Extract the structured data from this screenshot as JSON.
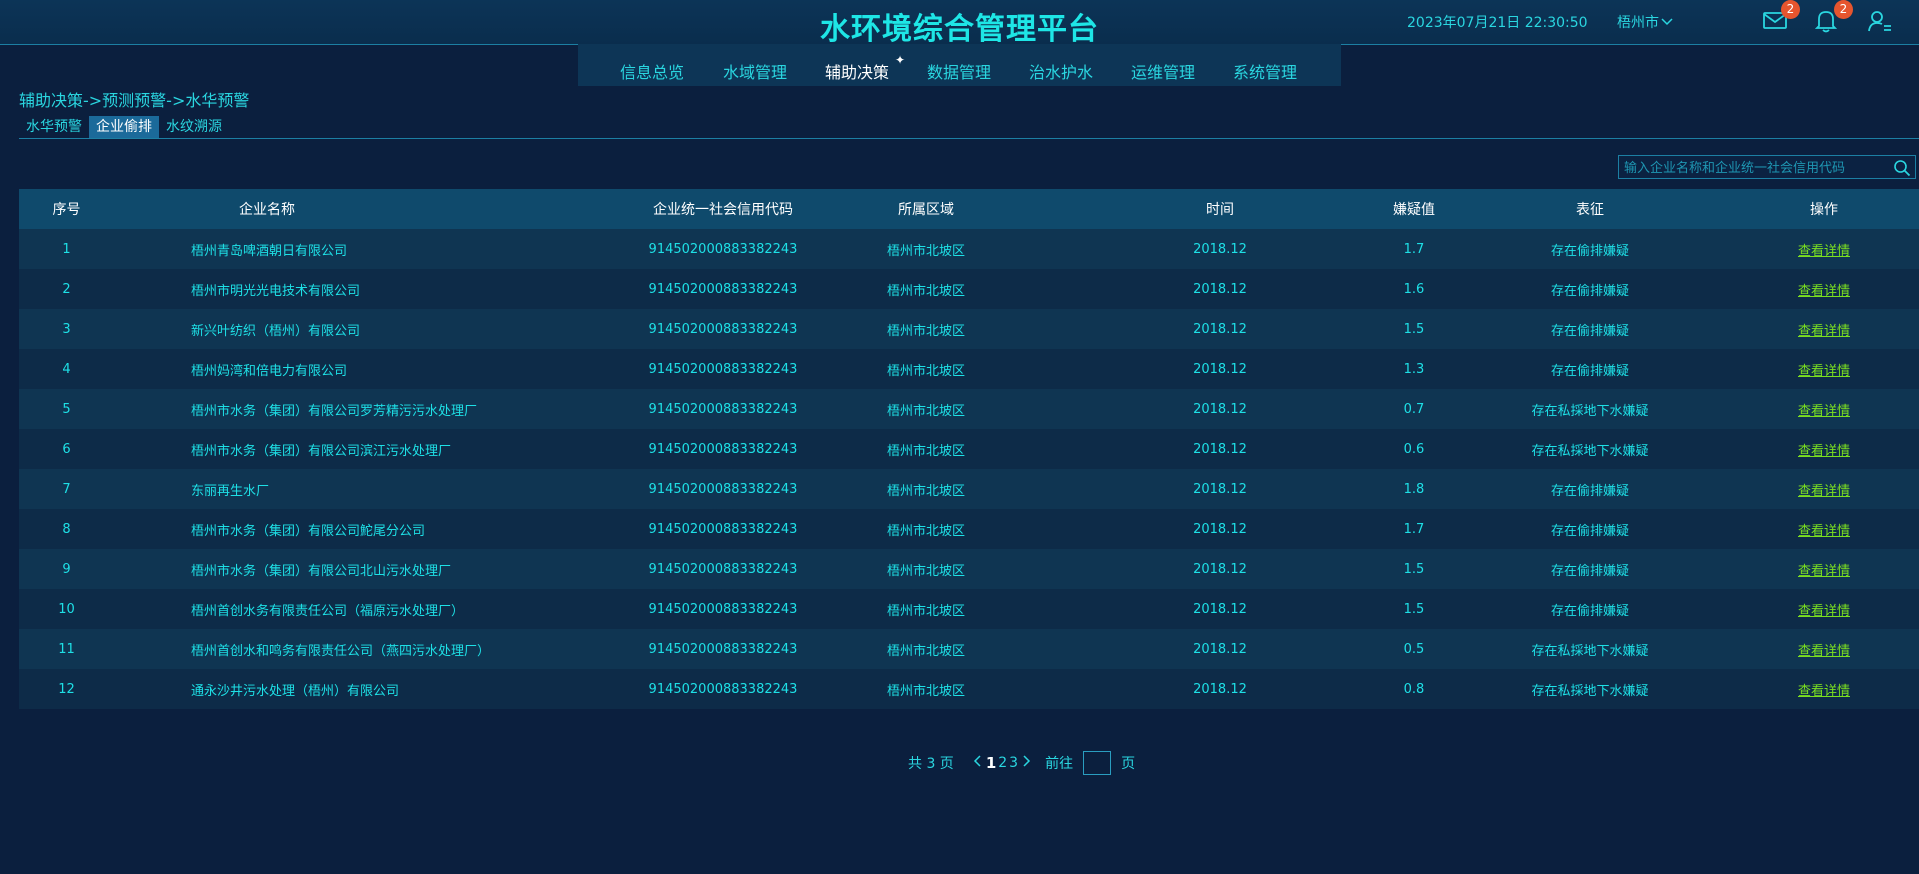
{
  "header": {
    "title": "水环境综合管理平台",
    "datetime": "2023年07月21日 22:30:50",
    "city": "梧州市",
    "mail_count": "2",
    "bell_count": "2"
  },
  "nav": {
    "items": [
      "信息总览",
      "水域管理",
      "辅助决策",
      "数据管理",
      "治水护水",
      "运维管理",
      "系统管理"
    ],
    "active": "辅助决策"
  },
  "breadcrumb": "辅助决策->预测预警->水华预警",
  "tabs": [
    "水华预警",
    "企业偷排",
    "水纹溯源"
  ],
  "search": {
    "placeholder": "输入企业名称和企业统一社会信用代码"
  },
  "table": {
    "headers": [
      "序号",
      "企业名称",
      "企业统一社会信用代码",
      "所属区域",
      "时间",
      "嫌疑值",
      "表征",
      "操作"
    ],
    "rows": [
      [
        "1",
        "梧州青岛啤酒朝日有限公司",
        "914502000883382243",
        "梧州市北坡区",
        "2018.12",
        "1.7",
        "存在偷排嫌疑",
        "查看详情"
      ],
      [
        "2",
        "梧州市明光光电技术有限公司",
        "914502000883382243",
        "梧州市北坡区",
        "2018.12",
        "1.6",
        "存在偷排嫌疑",
        "查看详情"
      ],
      [
        "3",
        "新兴叶纺织（梧州）有限公司",
        "914502000883382243",
        "梧州市北坡区",
        "2018.12",
        "1.5",
        "存在偷排嫌疑",
        "查看详情"
      ],
      [
        "4",
        "梧州妈湾和倍电力有限公司",
        "914502000883382243",
        "梧州市北坡区",
        "2018.12",
        "1.3",
        "存在偷排嫌疑",
        "查看详情"
      ],
      [
        "5",
        "梧州市水务（集团）有限公司罗芳精污污水处理厂",
        "914502000883382243",
        "梧州市北坡区",
        "2018.12",
        "0.7",
        "存在私採地下水嫌疑",
        "查看详情"
      ],
      [
        "6",
        "梧州市水务（集团）有限公司滨江污水处理厂",
        "914502000883382243",
        "梧州市北坡区",
        "2018.12",
        "0.6",
        "存在私採地下水嫌疑",
        "查看详情"
      ],
      [
        "7",
        "东丽再生水厂",
        "914502000883382243",
        "梧州市北坡区",
        "2018.12",
        "1.8",
        "存在偷排嫌疑",
        "查看详情"
      ],
      [
        "8",
        "梧州市水务（集团）有限公司鮀尾分公司",
        "914502000883382243",
        "梧州市北坡区",
        "2018.12",
        "1.7",
        "存在偷排嫌疑",
        "查看详情"
      ],
      [
        "9",
        "梧州市水务（集团）有限公司北山污水处理厂",
        "914502000883382243",
        "梧州市北坡区",
        "2018.12",
        "1.5",
        "存在偷排嫌疑",
        "查看详情"
      ],
      [
        "10",
        "梧州首创水务有限责任公司（福原污水处理厂）",
        "914502000883382243",
        "梧州市北坡区",
        "2018.12",
        "1.5",
        "存在偷排嫌疑",
        "查看详情"
      ],
      [
        "11",
        "梧州首创水和鸣务有限责任公司（燕四污水处理厂）",
        "914502000883382243",
        "梧州市北坡区",
        "2018.12",
        "0.5",
        "存在私採地下水嫌疑",
        "查看详情"
      ],
      [
        "12",
        "通永沙井污水处理（梧州）有限公司",
        "914502000883382243",
        "梧州市北坡区",
        "2018.12",
        "0.8",
        "存在私採地下水嫌疑",
        "查看详情"
      ]
    ]
  },
  "pager": {
    "total": "共 3 页",
    "pages": [
      "1",
      "2",
      "3"
    ],
    "current": "1",
    "goto_label": "前往",
    "page_suffix": "页"
  },
  "colors": {
    "background": "#0b1f3e",
    "accent": "#1ee0e6",
    "link": "#7be020",
    "badge": "#e6552e"
  }
}
